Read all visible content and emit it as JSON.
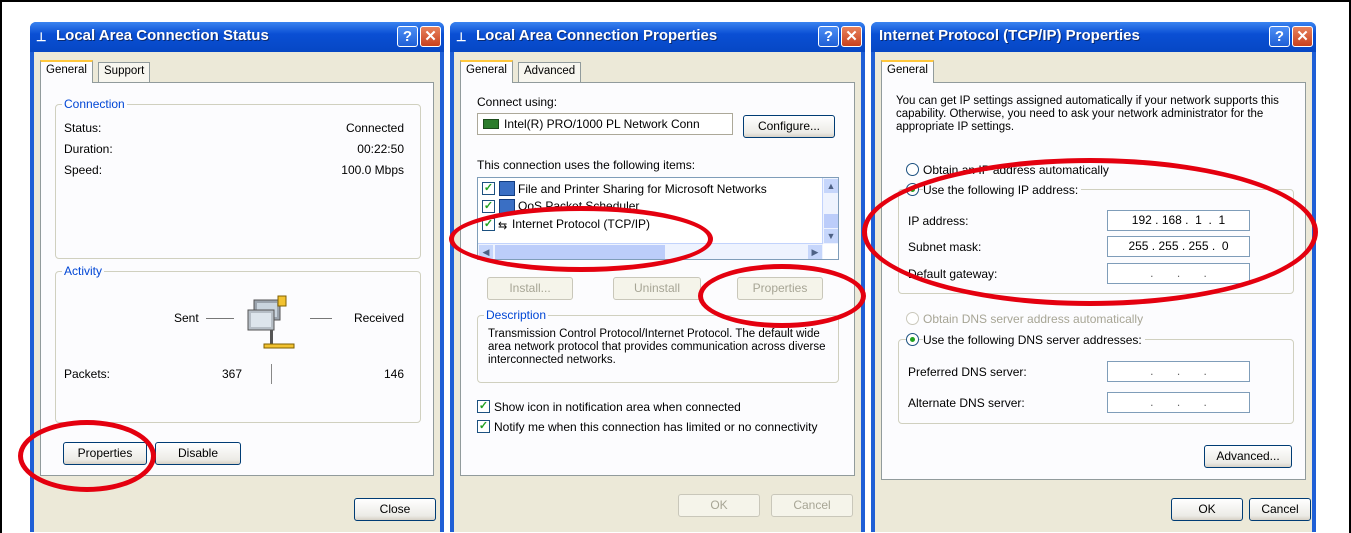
{
  "status_dialog": {
    "title": "Local Area Connection Status",
    "tabs": [
      "General",
      "Support"
    ],
    "connection_group": "Connection",
    "rows": [
      {
        "label": "Status:",
        "value": "Connected"
      },
      {
        "label": "Duration:",
        "value": "00:22:50"
      },
      {
        "label": "Speed:",
        "value": "100.0 Mbps"
      }
    ],
    "activity_group": "Activity",
    "sent_label": "Sent",
    "received_label": "Received",
    "packets_label": "Packets:",
    "packets_sent": "367",
    "packets_received": "146",
    "properties_button": "Properties",
    "disable_button": "Disable",
    "close_button": "Close"
  },
  "properties_dialog": {
    "title": "Local Area Connection Properties",
    "tabs": [
      "General",
      "Advanced"
    ],
    "connect_using_label": "Connect using:",
    "adapter_name": "Intel(R) PRO/1000 PL Network Conn",
    "configure_button": "Configure...",
    "items_label": "This connection uses the following items:",
    "items": [
      {
        "label": "File and Printer Sharing for Microsoft Networks",
        "checked": true
      },
      {
        "label": "QoS Packet Scheduler",
        "checked": true
      },
      {
        "label": "Internet Protocol (TCP/IP)",
        "checked": true
      }
    ],
    "install_button": "Install...",
    "uninstall_button": "Uninstall",
    "properties_button": "Properties",
    "description_group": "Description",
    "description_text": "Transmission Control Protocol/Internet Protocol. The default wide area network protocol that provides communication across diverse interconnected networks.",
    "show_icon_label": "Show icon in notification area when connected",
    "notify_label": "Notify me when this connection has limited or no connectivity",
    "ok_button": "OK",
    "cancel_button": "Cancel"
  },
  "tcpip_dialog": {
    "title": "Internet Protocol (TCP/IP) Properties",
    "tabs": [
      "General"
    ],
    "intro_text": "You can get IP settings assigned automatically if your network supports this capability. Otherwise, you need to ask your network administrator for the appropriate IP settings.",
    "obtain_ip_auto": "Obtain an IP address automatically",
    "use_following_ip": "Use the following IP address:",
    "ip_address_label": "IP address:",
    "ip_address_value": "192 . 168 .  1  .  1",
    "subnet_mask_label": "Subnet mask:",
    "subnet_mask_value": "255 . 255 . 255 .  0",
    "default_gateway_label": "Default gateway:",
    "default_gateway_value": ".       .       .",
    "obtain_dns_auto": "Obtain DNS server address automatically",
    "use_following_dns": "Use the following DNS server addresses:",
    "preferred_dns_label": "Preferred DNS server:",
    "preferred_dns_value": ".       .       .",
    "alternate_dns_label": "Alternate DNS server:",
    "alternate_dns_value": ".       .       .",
    "advanced_button": "Advanced...",
    "ok_button": "OK",
    "cancel_button": "Cancel"
  },
  "colors": {
    "title_bar": "#0a4fd4",
    "dialog_face": "#ece9d8",
    "highlight_ellipse": "#e4000f",
    "group_title": "#0046d5"
  }
}
